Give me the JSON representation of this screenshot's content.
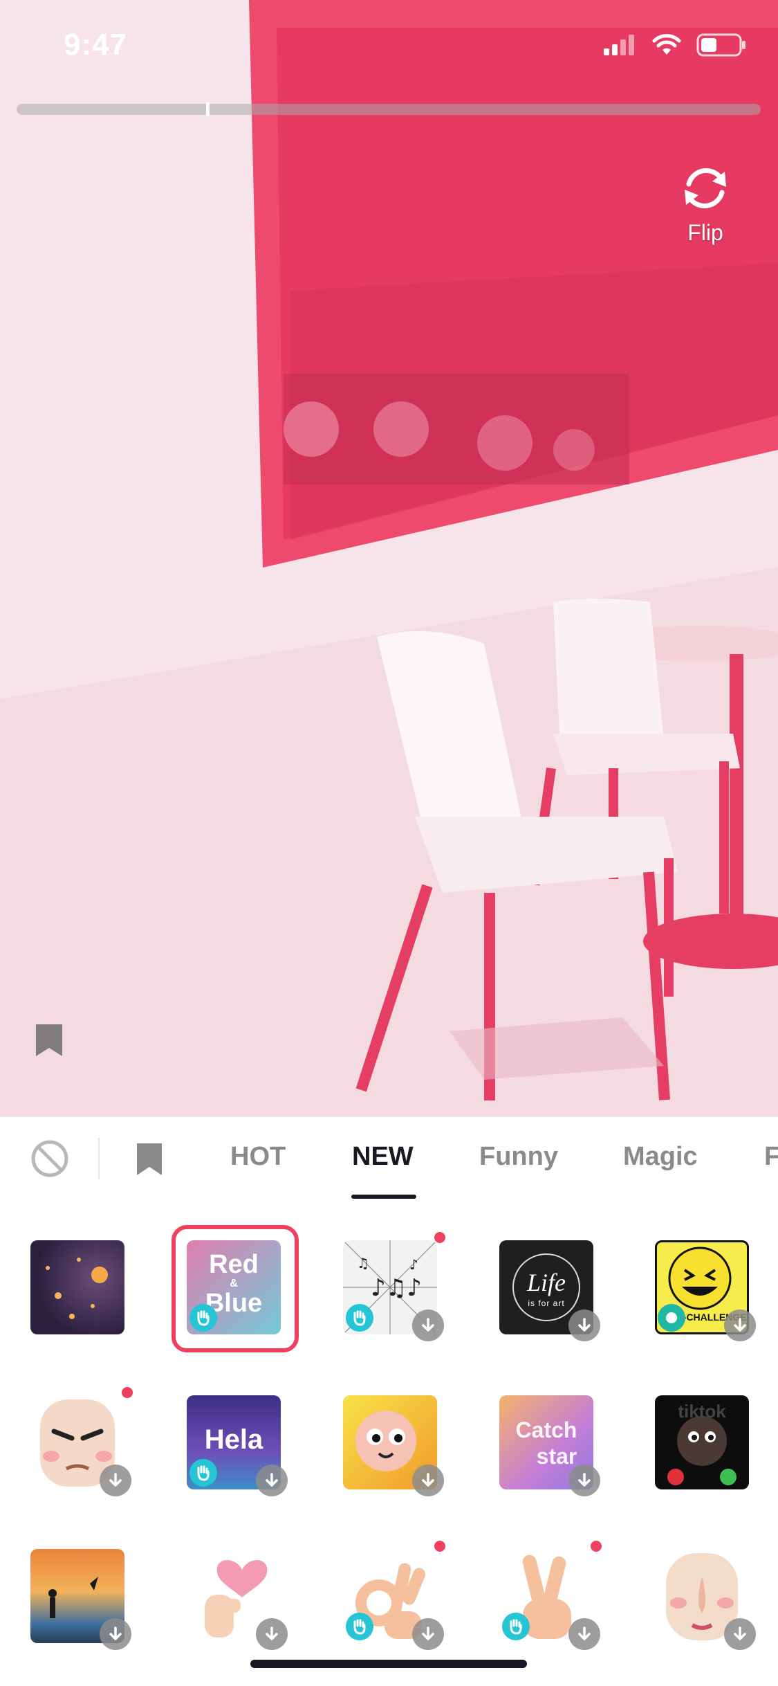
{
  "status_bar": {
    "time": "9:47"
  },
  "camera": {
    "flip_label": "Flip"
  },
  "tabs": [
    {
      "label": "HOT",
      "active": false
    },
    {
      "label": "NEW",
      "active": true
    },
    {
      "label": "Funny",
      "active": false
    },
    {
      "label": "Magic",
      "active": false
    },
    {
      "label": "F",
      "active": false
    }
  ],
  "effects": [
    {
      "name": "lanterns"
    },
    {
      "name": "red-blue",
      "text_top": "Red",
      "text_mid": "&",
      "text_bottom": "Blue",
      "selected": true
    },
    {
      "name": "music-notes"
    },
    {
      "name": "life",
      "text_top": "Life",
      "text_bottom": "is for art"
    },
    {
      "name": "face-challenge",
      "text": "FACE-CHALLENGE"
    },
    {
      "name": "angry-face"
    },
    {
      "name": "hela",
      "text": "Hela"
    },
    {
      "name": "cartoon-face"
    },
    {
      "name": "catch-star",
      "text_top": "Catch",
      "text_bottom": "star"
    },
    {
      "name": "call-face",
      "text": "tiktok"
    },
    {
      "name": "sunset-silhouette"
    },
    {
      "name": "finger-heart"
    },
    {
      "name": "ok-hand"
    },
    {
      "name": "peace-hand"
    },
    {
      "name": "nose-face"
    }
  ],
  "colors": {
    "accent": "#f0405f",
    "hand_badge": "#25c5d6",
    "camera_tint": "#ee3b63",
    "text_dark": "#161823",
    "text_muted": "#8a8a8a"
  }
}
